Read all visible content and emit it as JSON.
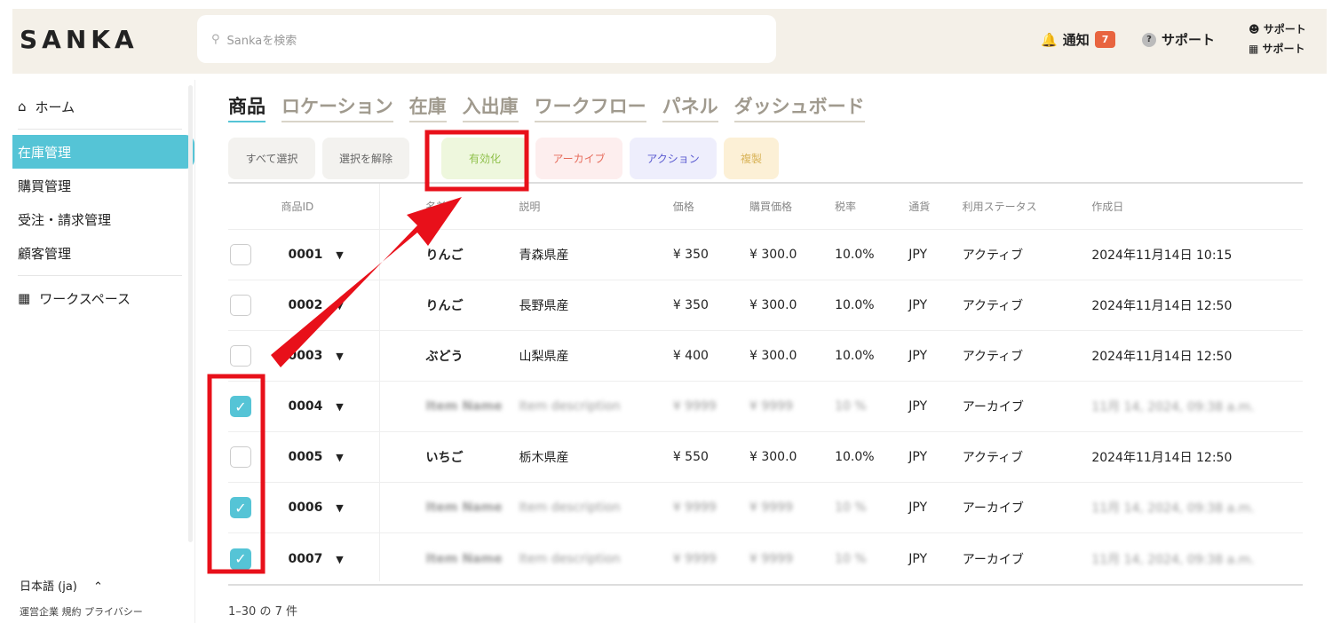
{
  "header": {
    "logo": "SANKA",
    "search_placeholder": "Sankaを検索",
    "notifications_label": "通知",
    "notifications_count": "7",
    "support_label": "サポート",
    "user_line1": "サポート",
    "user_line2": "サポート"
  },
  "sidebar": {
    "items": [
      {
        "label": "ホーム"
      },
      {
        "label": "在庫管理"
      },
      {
        "label": "購買管理"
      },
      {
        "label": "受注・請求管理"
      },
      {
        "label": "顧客管理"
      },
      {
        "label": "ワークスペース"
      }
    ],
    "language": "日本語 (ja)",
    "links": [
      "運営企業",
      "規約",
      "プライバシー"
    ]
  },
  "tabs": [
    "商品",
    "ロケーション",
    "在庫",
    "入出庫",
    "ワークフロー",
    "パネル",
    "ダッシュボード"
  ],
  "actions": [
    {
      "label": "すべて選択",
      "bg": "#f3f2ef",
      "fg": "#666"
    },
    {
      "label": "選択を解除",
      "bg": "#f3f2ef",
      "fg": "#666"
    },
    {
      "label": "有効化",
      "bg": "#eef7dd",
      "fg": "#8fc04a"
    },
    {
      "label": "アーカイブ",
      "bg": "#fdeeee",
      "fg": "#e66b5b"
    },
    {
      "label": "アクション",
      "bg": "#eeeefc",
      "fg": "#5a5ad0"
    },
    {
      "label": "複製",
      "bg": "#fcf0d6",
      "fg": "#d9b45a"
    }
  ],
  "table": {
    "headers": [
      "商品ID",
      "名前",
      "説明",
      "価格",
      "購買価格",
      "税率",
      "通貨",
      "利用ステータス",
      "作成日"
    ],
    "rows": [
      {
        "checked": false,
        "id": "0001",
        "name": "りんご",
        "desc": "青森県産",
        "price": "¥ 350",
        "cost": "¥ 300.0",
        "tax": "10.0%",
        "currency": "JPY",
        "status": "アクティブ",
        "created": "2024年11月14日 10:15",
        "blurred": false
      },
      {
        "checked": false,
        "id": "0002",
        "name": "りんご",
        "desc": "長野県産",
        "price": "¥ 350",
        "cost": "¥ 300.0",
        "tax": "10.0%",
        "currency": "JPY",
        "status": "アクティブ",
        "created": "2024年11月14日 12:50",
        "blurred": false
      },
      {
        "checked": false,
        "id": "0003",
        "name": "ぶどう",
        "desc": "山梨県産",
        "price": "¥ 400",
        "cost": "¥ 300.0",
        "tax": "10.0%",
        "currency": "JPY",
        "status": "アクティブ",
        "created": "2024年11月14日 12:50",
        "blurred": false
      },
      {
        "checked": true,
        "id": "0004",
        "name": "Item Name",
        "desc": "Item description",
        "price": "¥ 9999",
        "cost": "¥ 9999",
        "tax": "10 %",
        "currency": "JPY",
        "status": "アーカイブ",
        "created": "11月 14, 2024, 09:38 a.m.",
        "blurred": true
      },
      {
        "checked": false,
        "id": "0005",
        "name": "いちご",
        "desc": "栃木県産",
        "price": "¥ 550",
        "cost": "¥ 300.0",
        "tax": "10.0%",
        "currency": "JPY",
        "status": "アクティブ",
        "created": "2024年11月14日 12:50",
        "blurred": false
      },
      {
        "checked": true,
        "id": "0006",
        "name": "Item Name",
        "desc": "Item description",
        "price": "¥ 9999",
        "cost": "¥ 9999",
        "tax": "10 %",
        "currency": "JPY",
        "status": "アーカイブ",
        "created": "11月 14, 2024, 09:38 a.m.",
        "blurred": true
      },
      {
        "checked": true,
        "id": "0007",
        "name": "Item Name",
        "desc": "Item description",
        "price": "¥ 9999",
        "cost": "¥ 9999",
        "tax": "10 %",
        "currency": "JPY",
        "status": "アーカイブ",
        "created": "11月 14, 2024, 09:38 a.m.",
        "blurred": true
      }
    ]
  },
  "pagination": "1–30 の 7 件"
}
